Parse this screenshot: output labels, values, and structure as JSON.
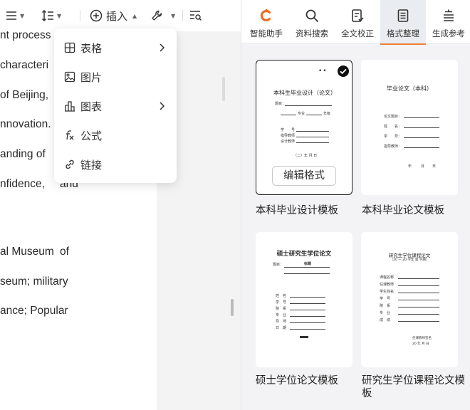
{
  "toolbar": {
    "insert_label": "插入"
  },
  "document": {
    "lines": [
      {
        "text": "nt  process"
      },
      {
        "text": "characteri"
      },
      {
        "text": "of  Beijing,"
      },
      {
        "text": "nnovation."
      },
      {
        "text": "anding  of"
      },
      {
        "text": "nfidence,",
        "right": "and"
      },
      {
        "text": "al  Museum",
        "right": "of"
      },
      {
        "text": "seum;  military"
      },
      {
        "text": "ance;  Popular"
      }
    ]
  },
  "insert_menu": {
    "items": [
      {
        "label": "表格",
        "icon": "table-icon",
        "submenu": true
      },
      {
        "label": "图片",
        "icon": "image-icon",
        "submenu": false
      },
      {
        "label": "图表",
        "icon": "chart-icon",
        "submenu": true
      },
      {
        "label": "公式",
        "icon": "formula-icon",
        "submenu": false
      },
      {
        "label": "链接",
        "icon": "link-icon",
        "submenu": false
      }
    ]
  },
  "panel": {
    "tabs": [
      {
        "label": "智能助手",
        "icon": "ai-assistant-icon",
        "active": false
      },
      {
        "label": "资料搜索",
        "icon": "search-icon",
        "active": false
      },
      {
        "label": "全文校正",
        "icon": "proofread-icon",
        "active": false
      },
      {
        "label": "格式整理",
        "icon": "format-icon",
        "active": true
      },
      {
        "label": "生成参考",
        "icon": "reference-icon",
        "active": false
      }
    ],
    "templates": [
      {
        "title": "本科毕业设计模板",
        "selected": true,
        "edit_label": "编辑格式",
        "preview": {
          "heading": "本科生毕业设计（论文）",
          "topic_label": "题目：",
          "major_label": "专业",
          "class_label": "年级",
          "fields": [
            "学　　号",
            "指导教师",
            "设计教师"
          ],
          "footer": "（二）年 月 日"
        }
      },
      {
        "title": "本科毕业论文模板",
        "selected": false,
        "preview": {
          "heading": "毕业论文（本科）",
          "fields": [
            "论文题目：",
            "姓　　名：",
            "学　　号：",
            "指导教师："
          ],
          "date": [
            "年",
            "月",
            "日"
          ]
        }
      },
      {
        "title": "硕士学位论文模板",
        "selected": false,
        "preview": {
          "heading": "硕士研究生学位论文",
          "title_label": "题目：",
          "title_value": "标题",
          "fields": [
            "姓　名",
            "学　号",
            "院　系",
            "专　业",
            "导　师",
            "日　期"
          ]
        }
      },
      {
        "title": "研究生学位课程论文模板",
        "selected": false,
        "preview": {
          "heading": "研究生学位课程论文",
          "sub": "（20   — 20   学年 第 学期）",
          "fields": [
            "课程名称",
            "任课教师",
            "学生姓名",
            "学　号",
            "院　系",
            "专　业",
            "成　绩"
          ],
          "footer_1": "任课教师签名",
          "footer_2": "20  年  月  日"
        }
      }
    ]
  }
}
